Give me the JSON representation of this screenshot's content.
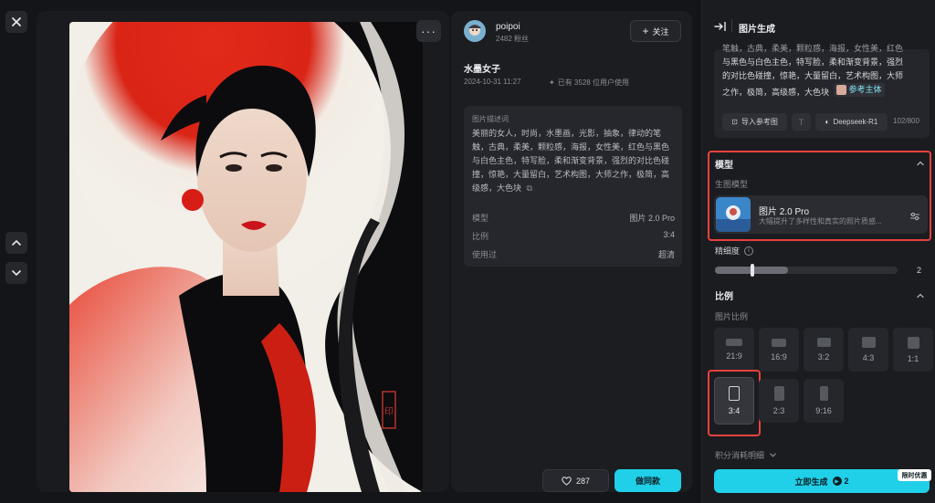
{
  "left_controls": {
    "close_icon": "close-icon",
    "up_icon": "chevron-up-icon",
    "down_icon": "chevron-down-icon"
  },
  "artwork": {
    "seal_text": "印"
  },
  "info": {
    "author": "poipoi",
    "followers": "2482 粉丝",
    "follow_label": "关注",
    "title": "水墨女子",
    "date": "2024-10-31 11:27",
    "usage": "已有 3528 位用户使用",
    "prompt_label": "图片描述词",
    "prompt_text": "美丽的女人，时尚，水墨画，光影，抽象，律动的笔触，古典，柔美，颗粒感，海报，女性美，红色与黑色与白色主色，特写脸，柔和渐变背景，强烈的对比色碰撞，惊艳，大量留白，艺术构图，大师之作，极简，高级感，大色块",
    "meta": [
      {
        "key": "模型",
        "value": "图片 2.0 Pro"
      },
      {
        "key": "比例",
        "value": "3:4"
      },
      {
        "key": "使用过",
        "value": "超清"
      }
    ],
    "like_count": "287",
    "same_label": "做同款"
  },
  "sidebar": {
    "title": "图片生成",
    "prompt_lines": [
      "笔触，古典，柔美，颗粒感，海报，女性美，红色",
      "与黑色与白色主色，特写脸，柔和渐变背景，强烈",
      "的对比色碰撞，惊艳，大量留白，艺术构图，大师",
      "之作，极简，高级感，大色块"
    ],
    "ref_tag": "参考主体",
    "import_ref": "导入参考图",
    "deepseek": "Deepseek-R1",
    "char_count": "102/800",
    "model_section": "模型",
    "gen_model_label": "生图模型",
    "model_name": "图片 2.0 Pro",
    "model_desc": "大幅提升了多样性和真实的照片质感...",
    "detail_label": "精细度",
    "detail_value": "2",
    "detail_level": 0.4,
    "ratio_section": "比例",
    "ratio_label": "图片比例",
    "ratios": [
      "21:9",
      "16:9",
      "3:2",
      "4:3",
      "1:1",
      "3:4",
      "2:3",
      "9:16"
    ],
    "selected_ratio": "3:4",
    "cost_label": "积分消耗明细",
    "generate_label": "立即生成",
    "generate_cost": "2",
    "promo_badge": "限时优惠"
  }
}
